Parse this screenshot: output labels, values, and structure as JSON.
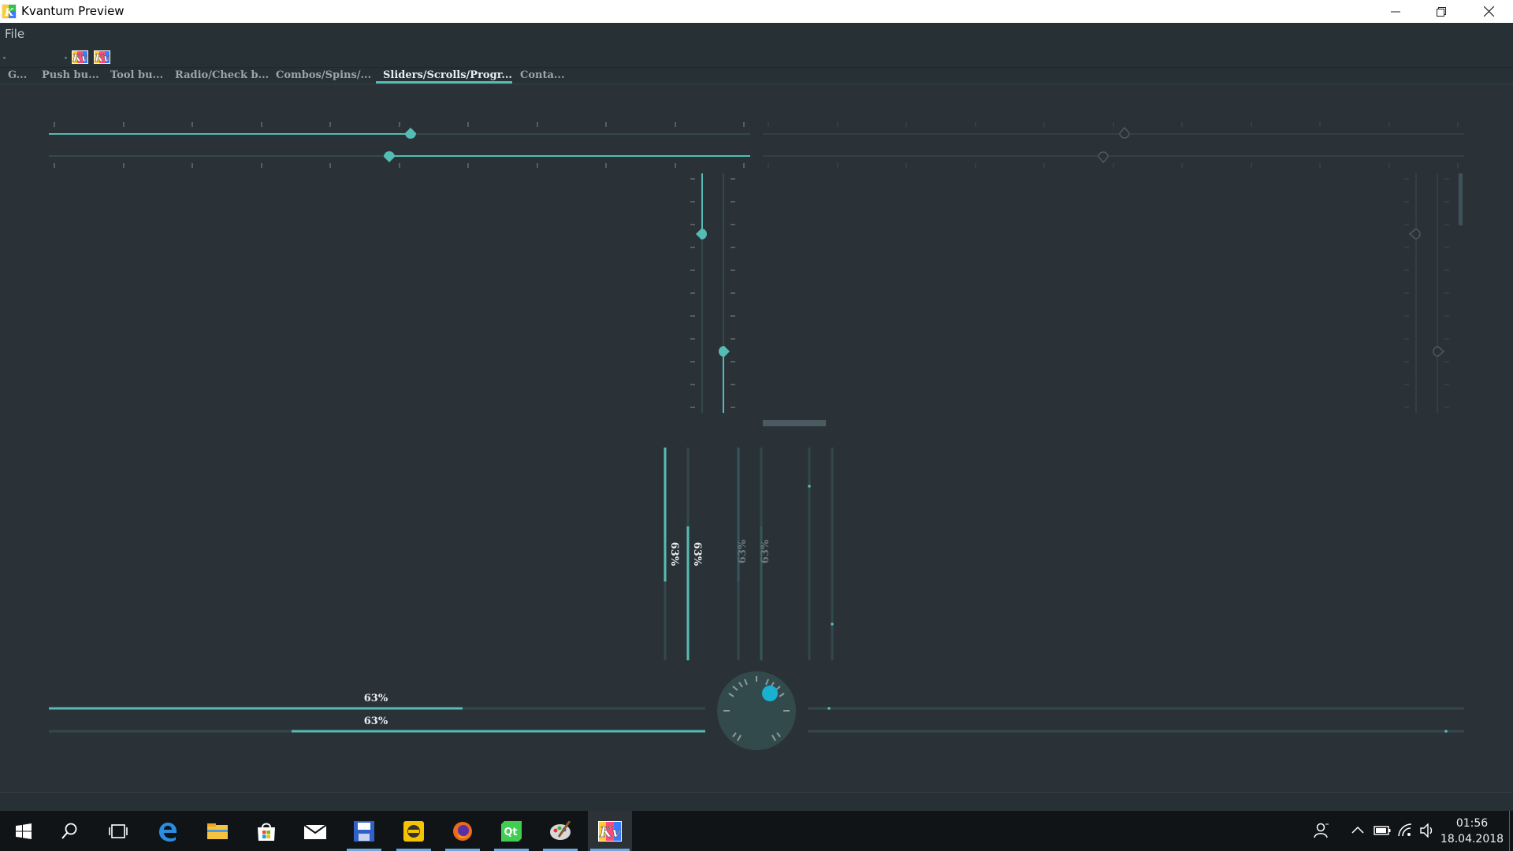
{
  "window": {
    "title": "Kvantum Preview",
    "minimize_symbol": "—",
    "maximize_symbol": "❐",
    "close_symbol": "✕"
  },
  "menubar": {
    "file_label": "File"
  },
  "toolbar": {
    "buttons": [
      {
        "icon": "kvantum-icon"
      },
      {
        "icon": "kvantum-icon"
      }
    ]
  },
  "tabs": [
    {
      "label": "G..."
    },
    {
      "label": "Push bu..."
    },
    {
      "label": "Tool bu..."
    },
    {
      "label": "Radio/Check b..."
    },
    {
      "label": "Combos/Spins/..."
    },
    {
      "label": "Sliders/Scrolls/Progr...",
      "active": true
    },
    {
      "label": "Conta..."
    }
  ],
  "sliders": {
    "horizontal_enabled_1": {
      "value": 0.51,
      "state": "enabled"
    },
    "horizontal_enabled_2": {
      "value": 0.49,
      "state": "enabled",
      "inverted": true
    },
    "horizontal_disabled_1": {
      "value": 0.51,
      "state": "disabled"
    },
    "horizontal_disabled_2": {
      "value": 0.49,
      "state": "disabled"
    },
    "vertical_enabled_1": {
      "value": 0.75,
      "state": "enabled"
    },
    "vertical_enabled_2": {
      "value": 0.25,
      "state": "enabled"
    },
    "vertical_disabled_1": {
      "value": 0.75,
      "state": "disabled"
    },
    "vertical_disabled_2": {
      "value": 0.25,
      "state": "disabled"
    }
  },
  "progress": {
    "percent_text": "63%",
    "value": 0.63,
    "vertical_bars": [
      {
        "text": "63%",
        "state": "enabled"
      },
      {
        "text": "63%",
        "state": "enabled"
      },
      {
        "text": "63%",
        "state": "disabled"
      },
      {
        "text": "63%",
        "state": "disabled"
      }
    ],
    "horizontal_bars": [
      {
        "text": "63%",
        "state": "enabled"
      },
      {
        "text": "63%",
        "state": "enabled",
        "inverted": true
      }
    ]
  },
  "dial": {
    "value": 0.55
  },
  "colors": {
    "accent": "#54bcb3",
    "dial_knob": "#1ab0cf",
    "background": "#2a3238",
    "groove": "#33484c"
  },
  "taskbar": {
    "apps": [
      {
        "icon": "start-icon"
      },
      {
        "icon": "search-icon"
      },
      {
        "icon": "task-view-icon"
      },
      {
        "icon": "edge-icon"
      },
      {
        "icon": "file-explorer-icon"
      },
      {
        "icon": "store-icon"
      },
      {
        "icon": "mail-icon"
      },
      {
        "icon": "save-app-icon",
        "running": true
      },
      {
        "icon": "app-yellow-icon",
        "running": true
      },
      {
        "icon": "firefox-icon",
        "running": true
      },
      {
        "icon": "qt-creator-icon",
        "running": true
      },
      {
        "icon": "paint-icon",
        "running": true
      },
      {
        "icon": "kvantum-icon",
        "running": true,
        "active": true
      }
    ],
    "time": "01:56",
    "date": "18.04.2018"
  }
}
